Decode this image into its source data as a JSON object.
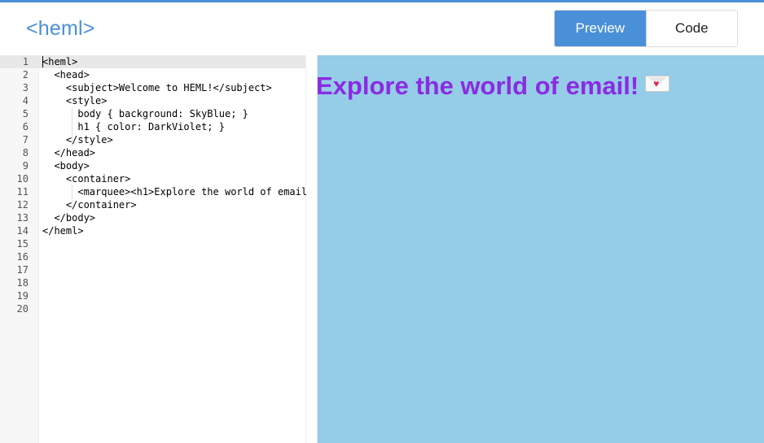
{
  "app": {
    "logo": "<heml>"
  },
  "view_toggle": {
    "preview_label": "Preview",
    "code_label": "Code",
    "active": "Preview"
  },
  "editor": {
    "lines": [
      {
        "num": "1",
        "text": "<heml>"
      },
      {
        "num": "2",
        "text": "  <head>"
      },
      {
        "num": "3",
        "text": "    <subject>Welcome to HEML!</subject>"
      },
      {
        "num": "4",
        "text": "    <style>"
      },
      {
        "num": "5",
        "text": "      body { background: SkyBlue; }"
      },
      {
        "num": "6",
        "text": "      h1 { color: DarkViolet; }"
      },
      {
        "num": "7",
        "text": "    </style>"
      },
      {
        "num": "8",
        "text": "  </head>"
      },
      {
        "num": "9",
        "text": "  <body>"
      },
      {
        "num": "10",
        "text": "    <container>"
      },
      {
        "num": "11",
        "text": "      <marquee><h1>Explore the world of email"
      },
      {
        "num": "12",
        "text": "    </container>"
      },
      {
        "num": "13",
        "text": "  </body>"
      },
      {
        "num": "14",
        "text": "</heml>"
      },
      {
        "num": "15",
        "text": ""
      },
      {
        "num": "16",
        "text": ""
      },
      {
        "num": "17",
        "text": ""
      },
      {
        "num": "18",
        "text": ""
      },
      {
        "num": "19",
        "text": ""
      },
      {
        "num": "20",
        "text": ""
      }
    ]
  },
  "preview": {
    "heading": "Explore the world of email!",
    "emoji_icon": "love-letter-icon",
    "heart_glyph": "♥"
  },
  "colors": {
    "accent": "#4a90d9",
    "preview_background": "#95cce8",
    "heading_color": "#8a2be2"
  }
}
